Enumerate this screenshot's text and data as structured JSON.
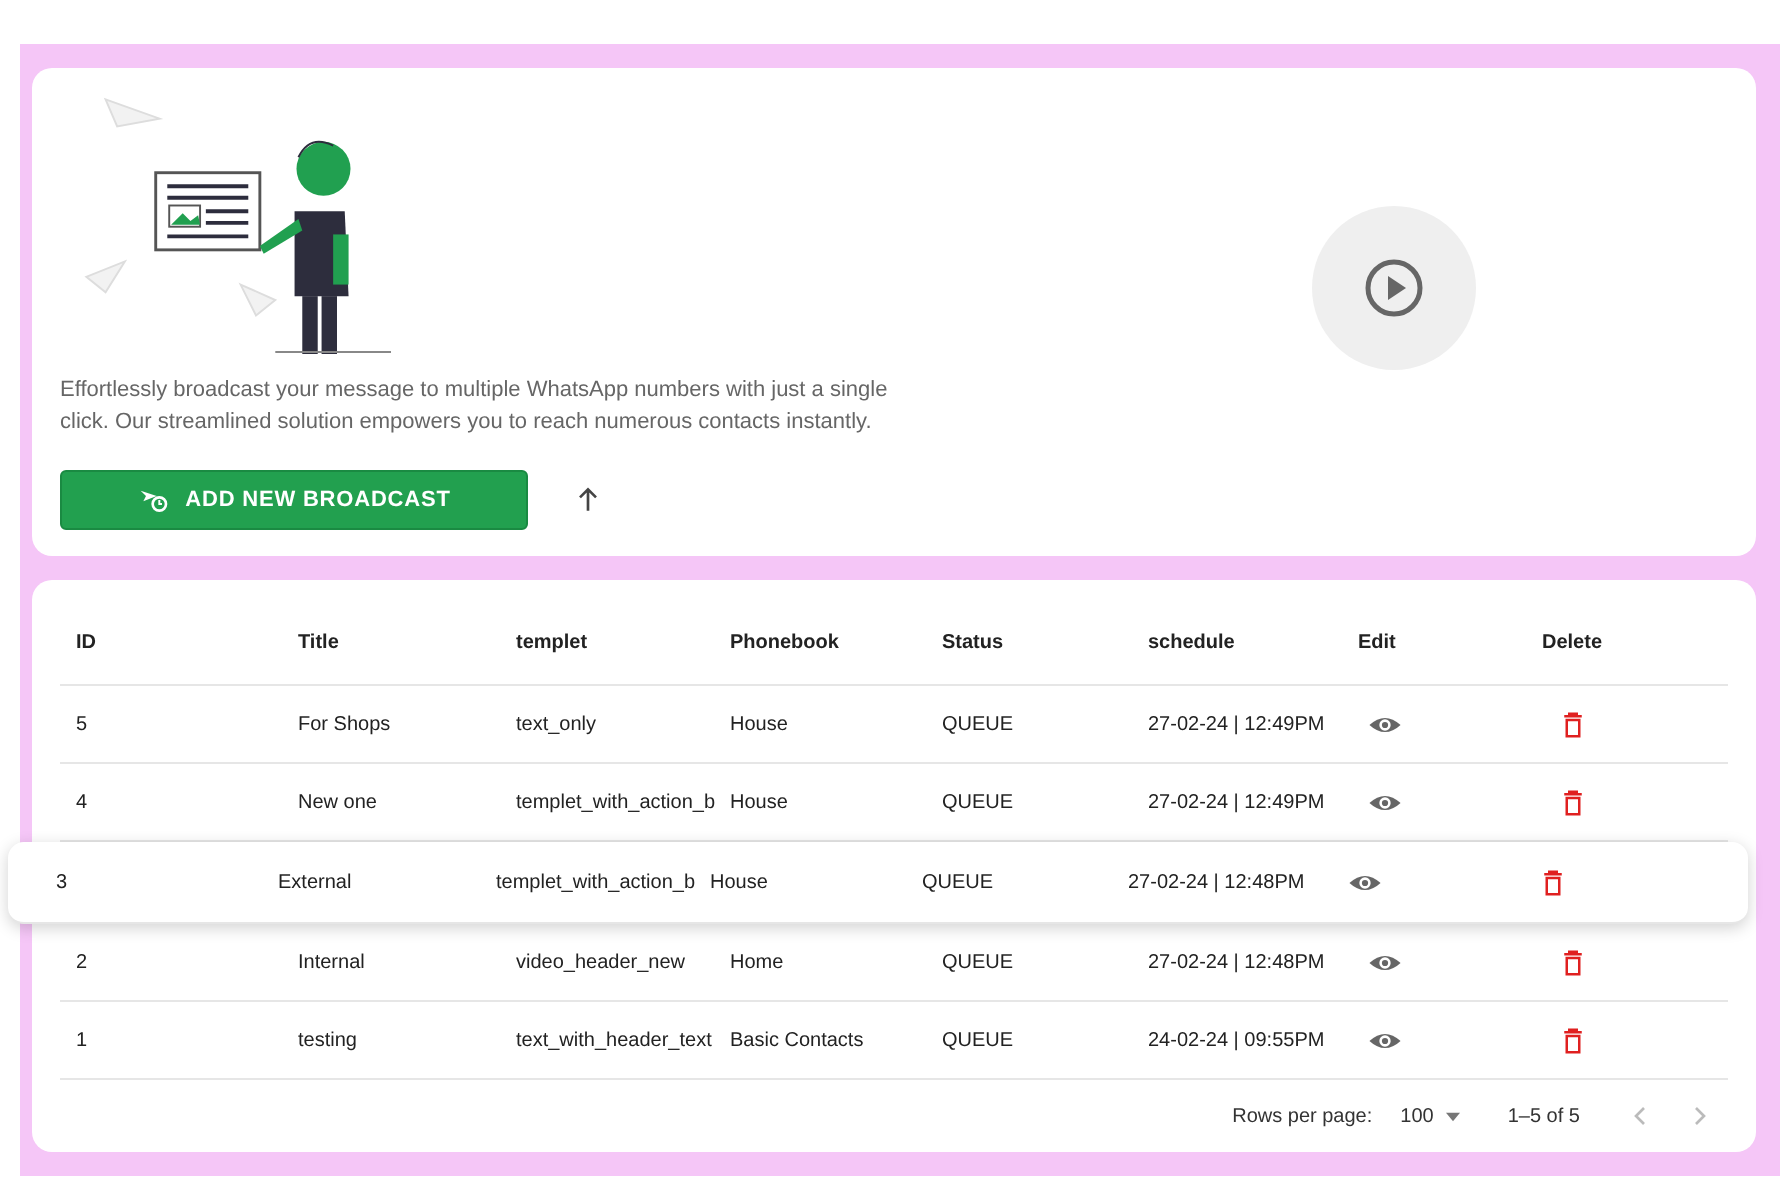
{
  "intro": {
    "description": "Effortlessly broadcast your message to multiple WhatsApp numbers with just a single click. Our streamlined solution empowers you to reach numerous contacts instantly.",
    "add_button": "ADD NEW BROADCAST"
  },
  "table": {
    "columns": [
      "ID",
      "Title",
      "templet",
      "Phonebook",
      "Status",
      "schedule",
      "Edit",
      "Delete"
    ],
    "rows": [
      {
        "id": "5",
        "title": "For Shops",
        "templet": "text_only",
        "phonebook": "House",
        "status": "QUEUE",
        "schedule": "27-02-24 | 12:49PM",
        "selected": false
      },
      {
        "id": "4",
        "title": "New one",
        "templet": "templet_with_action_b",
        "phonebook": "House",
        "status": "QUEUE",
        "schedule": "27-02-24 | 12:49PM",
        "selected": false
      },
      {
        "id": "3",
        "title": "External",
        "templet": "templet_with_action_b",
        "phonebook": "House",
        "status": "QUEUE",
        "schedule": "27-02-24 | 12:48PM",
        "selected": true
      },
      {
        "id": "2",
        "title": "Internal",
        "templet": "video_header_new",
        "phonebook": "Home",
        "status": "QUEUE",
        "schedule": "27-02-24 | 12:48PM",
        "selected": false
      },
      {
        "id": "1",
        "title": "testing",
        "templet": "text_with_header_text",
        "phonebook": "Basic Contacts",
        "status": "QUEUE",
        "schedule": "24-02-24 | 09:55PM",
        "selected": false
      }
    ]
  },
  "pagination": {
    "rows_per_page_label": "Rows per page:",
    "rows_per_page": "100",
    "range": "1–5 of 5"
  }
}
